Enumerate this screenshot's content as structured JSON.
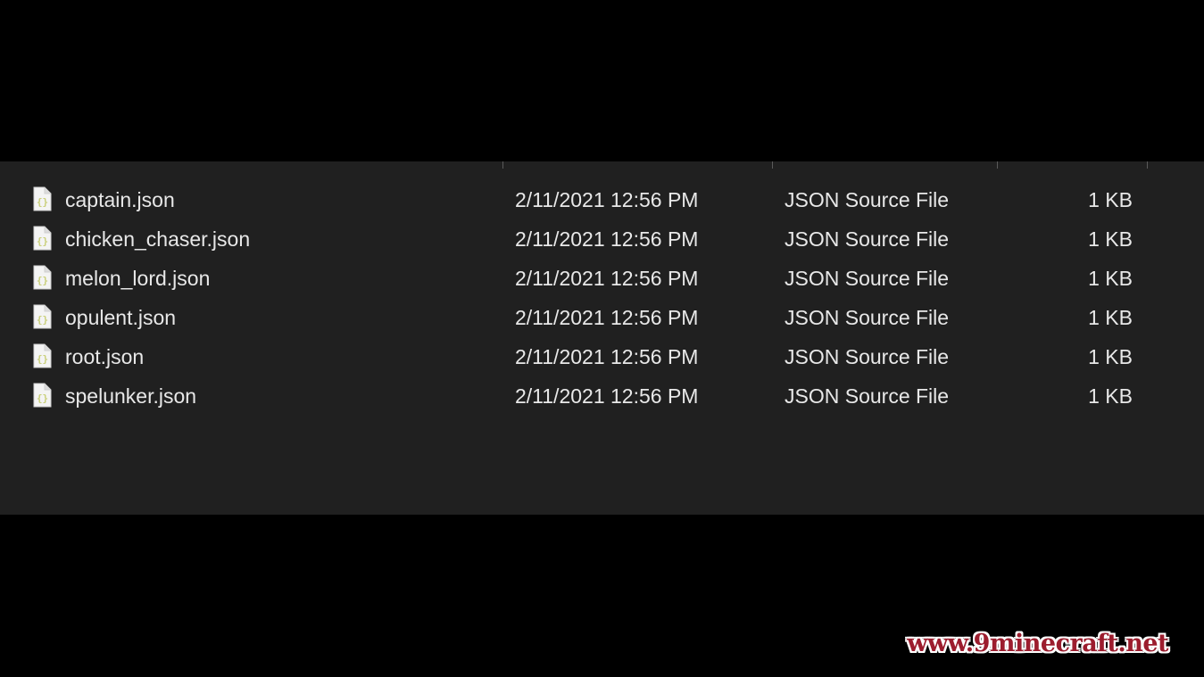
{
  "colors": {
    "page_background": "#000000",
    "panel_background": "#202020",
    "text": "#e8e8e8",
    "icon_accent": "#c9cf7a",
    "watermark": "#9c1d2e"
  },
  "files": [
    {
      "name": "captain.json",
      "date_modified": "2/11/2021 12:56 PM",
      "type": "JSON Source File",
      "size": "1 KB",
      "icon": "json-file-icon"
    },
    {
      "name": "chicken_chaser.json",
      "date_modified": "2/11/2021 12:56 PM",
      "type": "JSON Source File",
      "size": "1 KB",
      "icon": "json-file-icon"
    },
    {
      "name": "melon_lord.json",
      "date_modified": "2/11/2021 12:56 PM",
      "type": "JSON Source File",
      "size": "1 KB",
      "icon": "json-file-icon"
    },
    {
      "name": "opulent.json",
      "date_modified": "2/11/2021 12:56 PM",
      "type": "JSON Source File",
      "size": "1 KB",
      "icon": "json-file-icon"
    },
    {
      "name": "root.json",
      "date_modified": "2/11/2021 12:56 PM",
      "type": "JSON Source File",
      "size": "1 KB",
      "icon": "json-file-icon"
    },
    {
      "name": "spelunker.json",
      "date_modified": "2/11/2021 12:56 PM",
      "type": "JSON Source File",
      "size": "1 KB",
      "icon": "json-file-icon"
    }
  ],
  "watermark": {
    "text": "www.9minecraft.net"
  }
}
